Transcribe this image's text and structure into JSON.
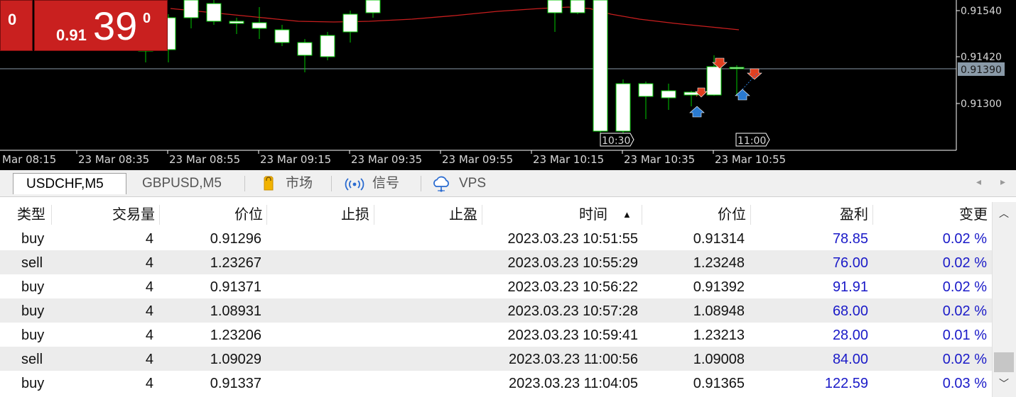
{
  "one_click": {
    "left_value": "0",
    "price_small": "0.91",
    "price_big": "39",
    "price_sup": "0"
  },
  "chart": {
    "price_axis": [
      "0.91540",
      "0.91420",
      "0.91300"
    ],
    "current_price": "0.91390",
    "time_axis": [
      "Mar 08:15",
      "23 Mar 08:35",
      "23 Mar 08:55",
      "23 Mar 09:15",
      "23 Mar 09:35",
      "23 Mar 09:55",
      "23 Mar 10:15",
      "23 Mar 10:35",
      "23 Mar 10:55"
    ],
    "marker_labels": [
      "10:30",
      "11:00"
    ],
    "colors": {
      "background": "#000000",
      "candle_bull_body": "#ffffff",
      "candle_outline": "#00c800",
      "moving_average": "#c81e1e",
      "price_line": "#8a9aa8",
      "sell_arrow": "#e04020",
      "buy_arrow": "#2a7ad0"
    }
  },
  "tabs": [
    {
      "label": "USDCHF,M5",
      "active": true
    },
    {
      "label": "GBPUSD,M5",
      "active": false
    },
    {
      "label": "市场",
      "icon": "shopping-bag-icon",
      "active": false
    },
    {
      "label": "信号",
      "icon": "signal-broadcast-icon",
      "active": false
    },
    {
      "label": "VPS",
      "icon": "cloud-icon",
      "active": false
    }
  ],
  "table": {
    "headers": [
      "类型",
      "交易量",
      "价位",
      "止损",
      "止盈",
      "时间",
      "价位",
      "盈利",
      "变更"
    ],
    "sort_indicator": "▲",
    "rows": [
      {
        "type": "buy",
        "volume": "4",
        "open_price": "0.91296",
        "sl": "",
        "tp": "",
        "time": "2023.03.23 10:51:55",
        "price": "0.91314",
        "profit": "78.85",
        "change": "0.02 %"
      },
      {
        "type": "sell",
        "volume": "4",
        "open_price": "1.23267",
        "sl": "",
        "tp": "",
        "time": "2023.03.23 10:55:29",
        "price": "1.23248",
        "profit": "76.00",
        "change": "0.02 %"
      },
      {
        "type": "buy",
        "volume": "4",
        "open_price": "0.91371",
        "sl": "",
        "tp": "",
        "time": "2023.03.23 10:56:22",
        "price": "0.91392",
        "profit": "91.91",
        "change": "0.02 %"
      },
      {
        "type": "buy",
        "volume": "4",
        "open_price": "1.08931",
        "sl": "",
        "tp": "",
        "time": "2023.03.23 10:57:28",
        "price": "1.08948",
        "profit": "68.00",
        "change": "0.02 %"
      },
      {
        "type": "buy",
        "volume": "4",
        "open_price": "1.23206",
        "sl": "",
        "tp": "",
        "time": "2023.03.23 10:59:41",
        "price": "1.23213",
        "profit": "28.00",
        "change": "0.01 %"
      },
      {
        "type": "sell",
        "volume": "4",
        "open_price": "1.09029",
        "sl": "",
        "tp": "",
        "time": "2023.03.23 11:00:56",
        "price": "1.09008",
        "profit": "84.00",
        "change": "0.02 %"
      },
      {
        "type": "buy",
        "volume": "4",
        "open_price": "0.91337",
        "sl": "",
        "tp": "",
        "time": "2023.03.23 11:04:05",
        "price": "0.91365",
        "profit": "122.59",
        "change": "0.03 %"
      }
    ]
  }
}
